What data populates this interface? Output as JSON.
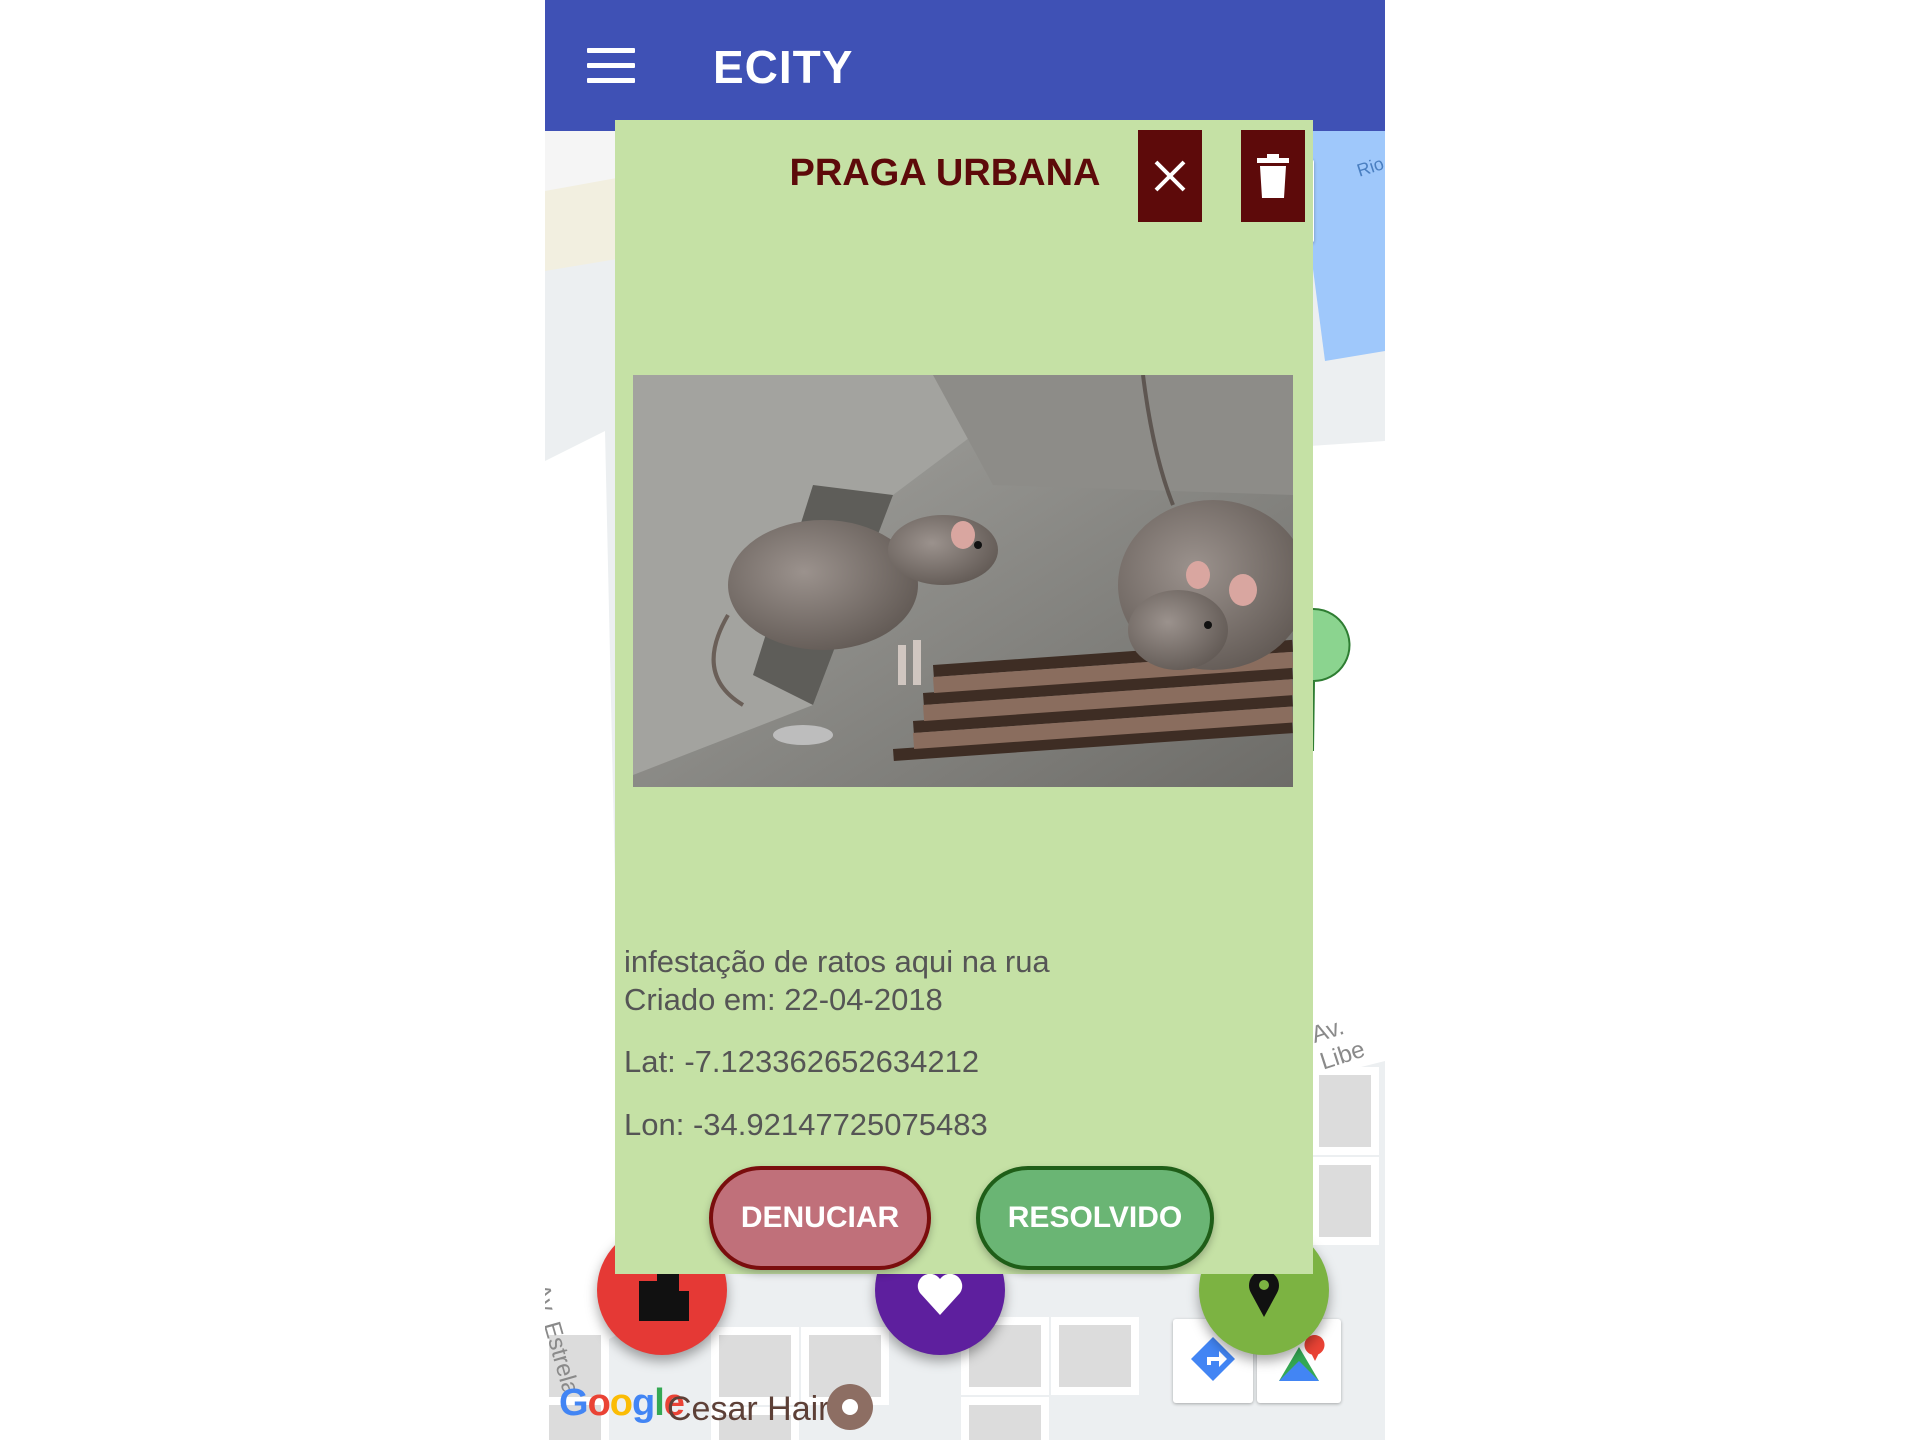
{
  "app_bar": {
    "title": "ECITY",
    "menu_icon": "hamburger-menu-icon",
    "color": "#3f51b5"
  },
  "dialog": {
    "title": "PRAGA URBANA",
    "close_icon": "close-icon",
    "delete_icon": "trash-icon",
    "photo": "rats-on-drain-photo",
    "description": "infestação de ratos aqui na rua",
    "created": "Criado em: 22-04-2018",
    "lat": "Lat: -7.123362652634212",
    "lon": "Lon: -34.92147725075483",
    "background": "#c5e1a5",
    "accent": "#5d0a0a",
    "buttons": {
      "report": "DENUCIAR",
      "resolved": "RESOLVIDO"
    }
  },
  "map": {
    "labels": {
      "river": "Rio",
      "avenue_right": "Av. Libe",
      "avenue_left": "Av. Estrela"
    },
    "google": "Google",
    "place": "Cesar Hair",
    "fabs": [
      {
        "icon": "building-icon",
        "color": "#e53935"
      },
      {
        "icon": "heart-icon",
        "color": "#5e1f9e"
      },
      {
        "icon": "location-pin-icon",
        "color": "#7cb342"
      }
    ]
  }
}
